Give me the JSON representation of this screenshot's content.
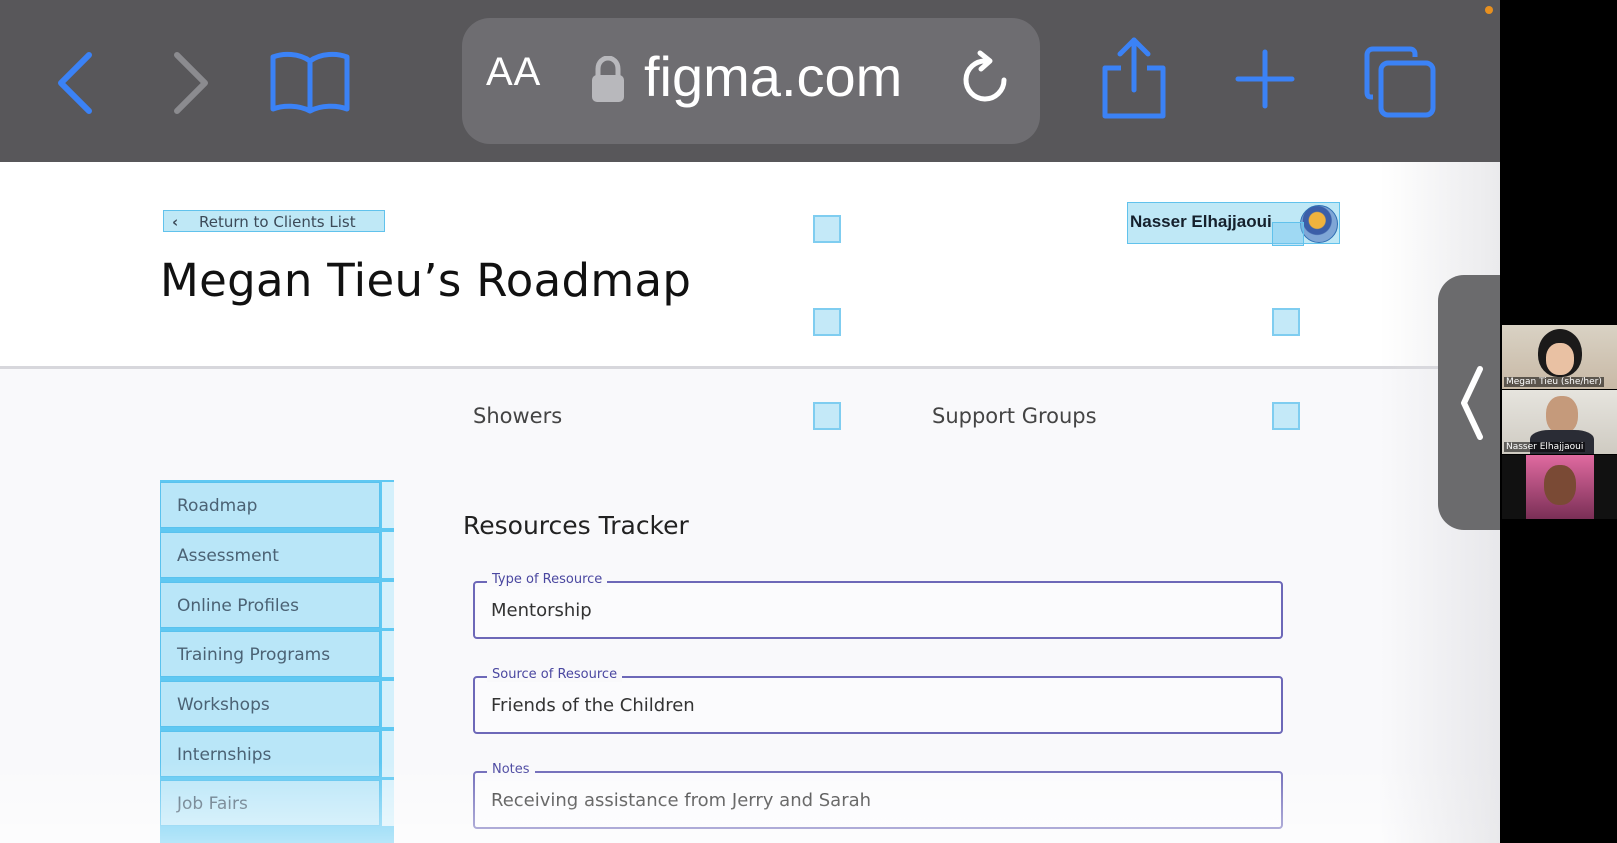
{
  "browser": {
    "text_size_button": "AA",
    "url": "figma.com",
    "icons": {
      "back": "chevron-left-icon",
      "forward": "chevron-right-icon",
      "bookmarks": "book-icon",
      "lock": "lock-icon",
      "reload": "reload-icon",
      "share": "share-icon",
      "new_tab": "plus-icon",
      "tabs": "tabs-icon"
    },
    "accent_color": "#3b82f6"
  },
  "header": {
    "back_link": "Return to Clients List",
    "user_name": "Nasser Elhajjaoui",
    "title": "Megan Tieu’s Roadmap"
  },
  "resources_rows": [
    {
      "label": "Showers"
    },
    {
      "label": "Support Groups"
    }
  ],
  "sidebar": {
    "items": [
      {
        "label": "Roadmap"
      },
      {
        "label": "Assessment"
      },
      {
        "label": "Online Profiles"
      },
      {
        "label": "Training Programs"
      },
      {
        "label": "Workshops"
      },
      {
        "label": "Internships"
      },
      {
        "label": "Job Fairs"
      }
    ]
  },
  "tracker": {
    "title": "Resources Tracker",
    "fields": [
      {
        "legend": "Type of Resource",
        "value": "Mentorship"
      },
      {
        "legend": "Source of Resource",
        "value": "Friends of the Children"
      },
      {
        "legend": "Notes",
        "value": "Receiving assistance from Jerry and Sarah"
      }
    ]
  },
  "video_call": {
    "participants": [
      {
        "name": "Megan Tieu (she/her)"
      },
      {
        "name": "Nasser Elhajjaoui"
      },
      {
        "name": ""
      }
    ]
  }
}
